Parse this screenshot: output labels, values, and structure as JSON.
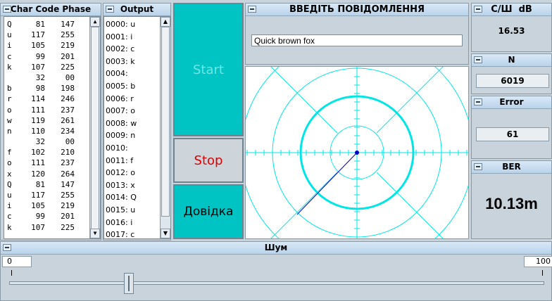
{
  "charcode": {
    "title": "Char Code Phase",
    "rows": [
      [
        "Q",
        "81",
        "147"
      ],
      [
        "u",
        "117",
        "255"
      ],
      [
        "i",
        "105",
        "219"
      ],
      [
        "c",
        "99",
        "201"
      ],
      [
        "k",
        "107",
        "225"
      ],
      [
        "",
        "32",
        "00"
      ],
      [
        "b",
        "98",
        "198"
      ],
      [
        "r",
        "114",
        "246"
      ],
      [
        "o",
        "111",
        "237"
      ],
      [
        "w",
        "119",
        "261"
      ],
      [
        "n",
        "110",
        "234"
      ],
      [
        "",
        "32",
        "00"
      ],
      [
        "f",
        "102",
        "210"
      ],
      [
        "o",
        "111",
        "237"
      ],
      [
        "x",
        "120",
        "264"
      ],
      [
        "Q",
        "81",
        "147"
      ],
      [
        "u",
        "117",
        "255"
      ],
      [
        "i",
        "105",
        "219"
      ],
      [
        "c",
        "99",
        "201"
      ],
      [
        "k",
        "107",
        "225"
      ]
    ]
  },
  "output": {
    "title": "Output",
    "rows": [
      "0000: u",
      "0001: i",
      "0002: c",
      "0003: k",
      "0004:",
      "0005: b",
      "0006: r",
      "0007: o",
      "0008: w",
      "0009: n",
      "0010:",
      "0011: f",
      "0012: o",
      "0013: x",
      "0014: Q",
      "0015: u",
      "0016: i",
      "0017: c"
    ]
  },
  "buttons": {
    "start": "Start",
    "stop": "Stop",
    "help": "Довідка"
  },
  "message": {
    "title": "ВВЕДІТЬ ПОВІДОМЛЕННЯ",
    "value": "Quick brown fox"
  },
  "snr": {
    "title": "С/Ш  dB",
    "value": "16.53"
  },
  "n": {
    "title": "N",
    "value": "6019"
  },
  "error": {
    "title": "Error",
    "value": "61"
  },
  "ber": {
    "title": "BER",
    "value": "10.13m"
  },
  "noise": {
    "title": "Шум",
    "min": "0",
    "max": "100",
    "level": 0.33
  },
  "colors": {
    "teal": "#00c4c4",
    "cyan": "#24dede",
    "polar": "#00e6e6",
    "vector": "#0000cc"
  }
}
